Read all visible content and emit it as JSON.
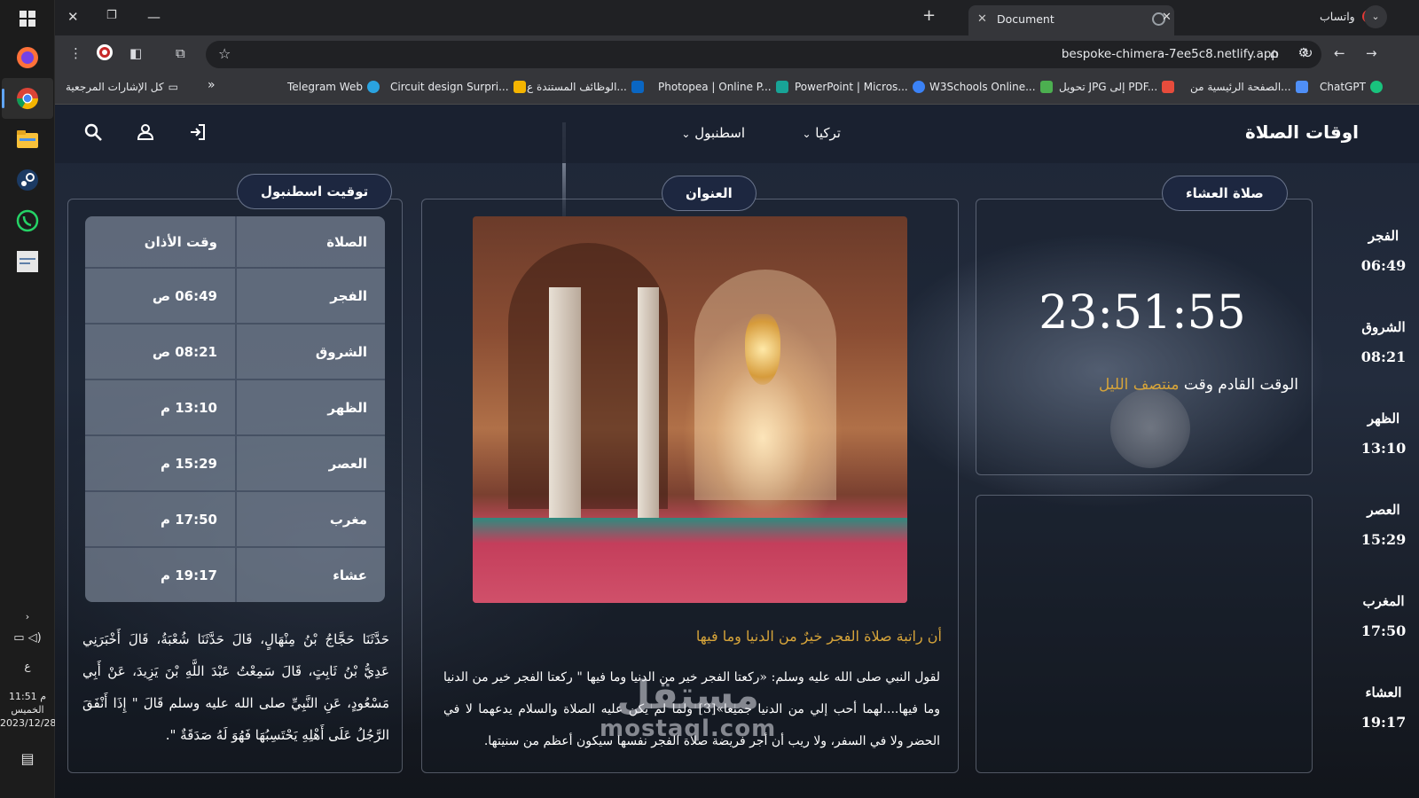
{
  "taskbar": {
    "clock_time": "11:51 م",
    "clock_day": "الخميس",
    "clock_date": "2023/12/28",
    "language": "ع"
  },
  "browser": {
    "tab_title": "Document",
    "whatsapp_tab": "واتساب",
    "url": "bespoke-chimera-7ee5c8.netlify.app",
    "bookmarks": [
      "ChatGPT",
      "الصفحة الرئيسية من...",
      "تحويل JPG إلى PDF...",
      "W3Schools Online...",
      "PowerPoint | Micros...",
      "Photopea | Online P...",
      "الوظائف المستندة ع...",
      "Circuit design Surpri...",
      "Telegram Web"
    ],
    "all_bookmarks": "كل الإشارات المرجعية",
    "bookmark_colors": [
      "#19c37d",
      "#4f8ff7",
      "#e74c3c",
      "#4caf50",
      "#3b82f6",
      "#18a497",
      "#0a66c2",
      "#f4b400",
      "#2aa3e0"
    ]
  },
  "header": {
    "title": "اوقات الصلاة",
    "country": "تركيا",
    "city": "اسطنبول"
  },
  "left": {
    "pill": "توقيت اسطنبول",
    "table_head": {
      "prayer": "الصلاة",
      "time": "وقت الأذان"
    },
    "rows": [
      {
        "name": "الفجر",
        "time": "06:49 ص"
      },
      {
        "name": "الشروق",
        "time": "08:21 ص"
      },
      {
        "name": "الظهر",
        "time": "13:10 م"
      },
      {
        "name": "العصر",
        "time": "15:29 م"
      },
      {
        "name": "مغرب",
        "time": "17:50 م"
      },
      {
        "name": "عشاء",
        "time": "19:17 م"
      }
    ],
    "hadith": "حَدَّثَنَا حَجَّاجُ بْنُ مِنْهَالٍ، قَالَ حَدَّثَنَا شُعْبَةُ، قَالَ أَخْبَرَنِي عَدِيُّ بْنُ ثَابِتٍ، قَالَ سَمِعْتُ عَبْدَ اللَّهِ بْنَ يَزِيدَ، عَنْ أَبِي مَسْعُودٍ، عَنِ النَّبِيِّ صلى الله عليه وسلم قَالَ \" إِذَا أَنْفَقَ الرَّجُلُ عَلَى أَهْلِهِ يَحْتَسِبُهَا فَهُوَ لَهُ صَدَقَةٌ \"."
  },
  "middle": {
    "pill": "العنوان",
    "article_title": "أن راتبة صلاة الفجر خيرٌ من الدنيا وما فيها",
    "article_body": "لقول النبي صلى الله عليه وسلم: «ركعتا الفجر خير من الدنيا وما فيها \" ركعتا الفجر خير من الدنيا وما فيها....لهما أحب إلي من الدنيا جميعا»[3] ولما لم يكن عليه الصلاة والسلام يدعهما لا في الحضر ولا في السفر، ولا ريب أن أجر فريضة صلاة الفجر نفسها سيكون أعظم من سنيتها.",
    "watermark_ar": "مستقل",
    "watermark_en": "mostaql.com"
  },
  "right": {
    "pill": "صلاة العشاء",
    "clock": "23:51:55",
    "next_prefix": "الوقت القادم وقت",
    "next_value": "منتصف الليل",
    "side": [
      {
        "name": "الفجر",
        "time": "06:49"
      },
      {
        "name": "الشروق",
        "time": "08:21"
      },
      {
        "name": "الظهر",
        "time": "13:10"
      },
      {
        "name": "العصر",
        "time": "15:29"
      },
      {
        "name": "المغرب",
        "time": "17:50"
      },
      {
        "name": "العشاء",
        "time": "19:17"
      }
    ]
  }
}
